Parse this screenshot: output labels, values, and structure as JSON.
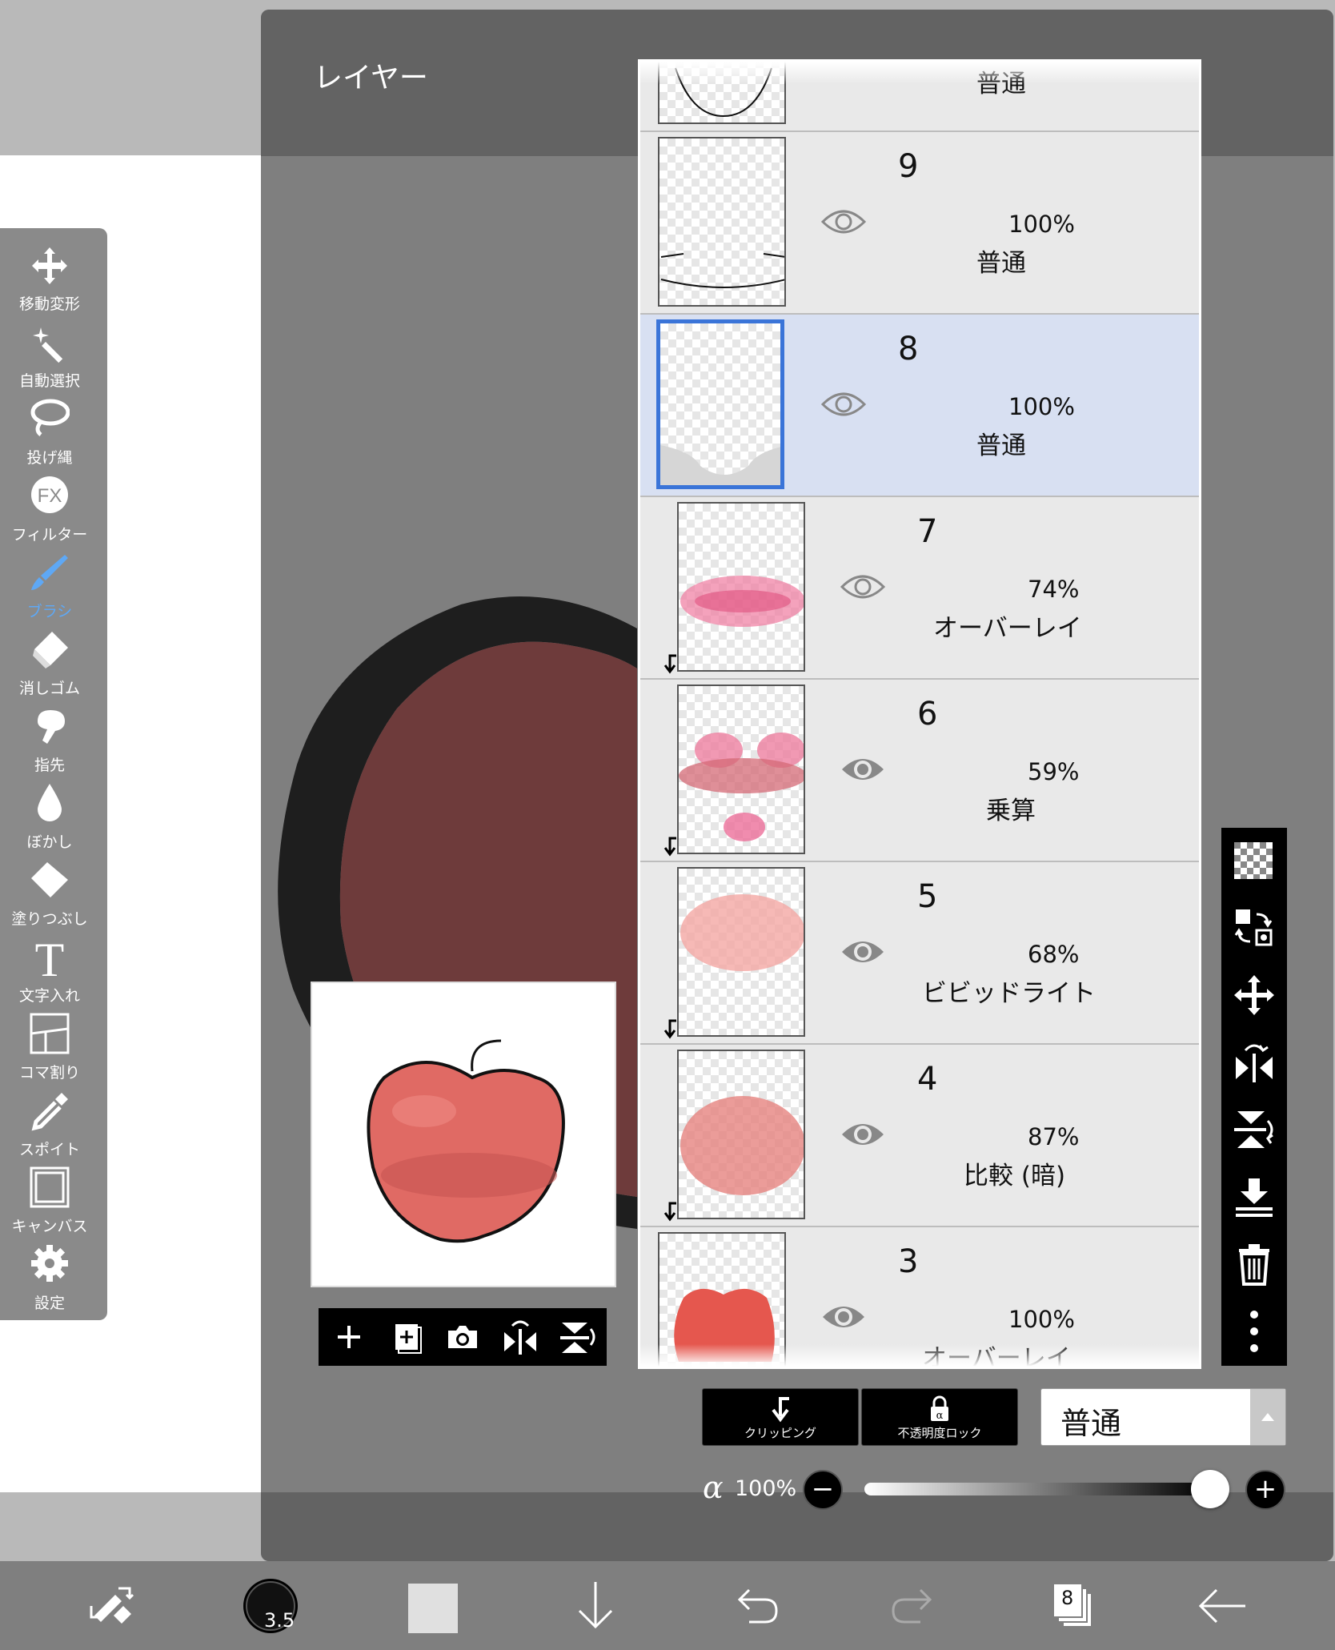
{
  "toolbar": {
    "items": [
      {
        "label": "移動変形",
        "icon": "move-transform-icon"
      },
      {
        "label": "自動選択",
        "icon": "magic-wand-icon"
      },
      {
        "label": "投げ縄",
        "icon": "lasso-icon"
      },
      {
        "label": "フィルター",
        "icon": "fx-filter-icon"
      },
      {
        "label": "ブラシ",
        "icon": "brush-icon",
        "active": true
      },
      {
        "label": "消しゴム",
        "icon": "eraser-icon"
      },
      {
        "label": "指先",
        "icon": "finger-smudge-icon"
      },
      {
        "label": "ぼかし",
        "icon": "blur-drop-icon"
      },
      {
        "label": "塗りつぶし",
        "icon": "fill-bucket-icon"
      },
      {
        "label": "文字入れ",
        "icon": "text-icon"
      },
      {
        "label": "コマ割り",
        "icon": "frame-divider-icon"
      },
      {
        "label": "スポイト",
        "icon": "eyedropper-icon"
      },
      {
        "label": "キャンバス",
        "icon": "canvas-icon"
      },
      {
        "label": "設定",
        "icon": "gear-icon"
      }
    ],
    "active_color": "#5ea8f5"
  },
  "layer_panel": {
    "title": "レイヤー",
    "top_partial_blend": "普通",
    "layers": [
      {
        "number": "9",
        "opacity": "100%",
        "blend": "普通",
        "visible": false,
        "clipped": false,
        "selected": false
      },
      {
        "number": "8",
        "opacity": "100%",
        "blend": "普通",
        "visible": false,
        "clipped": false,
        "selected": true
      },
      {
        "number": "7",
        "opacity": "74%",
        "blend": "オーバーレイ",
        "visible": false,
        "clipped": true,
        "selected": false
      },
      {
        "number": "6",
        "opacity": "59%",
        "blend": "乗算",
        "visible": true,
        "clipped": true,
        "selected": false
      },
      {
        "number": "5",
        "opacity": "68%",
        "blend": "ビビッドライト",
        "visible": true,
        "clipped": true,
        "selected": false
      },
      {
        "number": "4",
        "opacity": "87%",
        "blend": "比較 (暗)",
        "visible": true,
        "clipped": true,
        "selected": false
      },
      {
        "number": "3",
        "opacity": "100%",
        "blend": "オーバーレイ",
        "visible": true,
        "clipped": false,
        "selected": false
      }
    ],
    "selected_color": "#3a74d8"
  },
  "actions": {
    "clipping_label": "クリッピング",
    "alpha_lock_label": "不透明度ロック",
    "blend_mode": "普通",
    "alpha_symbol": "α",
    "alpha_value": "100%",
    "alpha_fraction": 1.0,
    "minus": "−",
    "plus": "+"
  },
  "bottom_bar": {
    "layer_count": "8",
    "brush_size": "3.5"
  },
  "colors": {
    "canvas_fill": "#6e3b3b",
    "apple_red": "#e06a64"
  }
}
